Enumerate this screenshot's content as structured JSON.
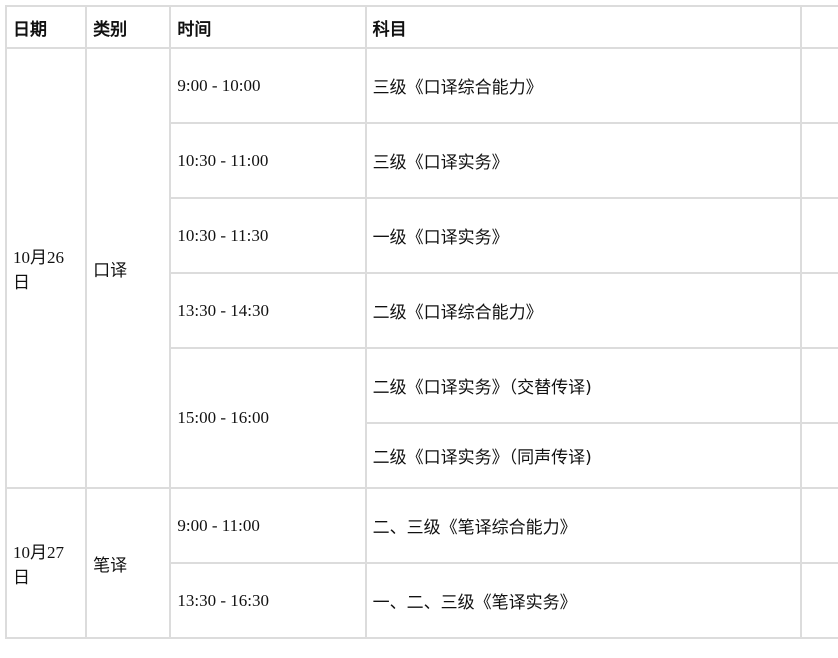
{
  "table": {
    "headers": [
      "日期",
      "类别",
      "时间",
      "科目"
    ],
    "groups": [
      {
        "date": "10月26日",
        "category": "口译",
        "sessions": [
          {
            "time": "9:00 - 10:00",
            "subjects": [
              "三级《口译综合能力》"
            ]
          },
          {
            "time": "10:30 - 11:00",
            "subjects": [
              "三级《口译实务》"
            ]
          },
          {
            "time": "10:30 - 11:30",
            "subjects": [
              "一级《口译实务》"
            ]
          },
          {
            "time": "13:30 - 14:30",
            "subjects": [
              "二级《口译综合能力》"
            ]
          },
          {
            "time": "15:00 - 16:00",
            "subjects": [
              "二级《口译实务》（交替传译)",
              "二级《口译实务》（同声传译)"
            ]
          }
        ]
      },
      {
        "date": "10月27日",
        "category": "笔译",
        "sessions": [
          {
            "time": "9:00 - 11:00",
            "subjects": [
              "二、三级《笔译综合能力》"
            ]
          },
          {
            "time": "13:30 - 16:30",
            "subjects": [
              "一、二、三级《笔译实务》"
            ]
          }
        ]
      }
    ]
  }
}
